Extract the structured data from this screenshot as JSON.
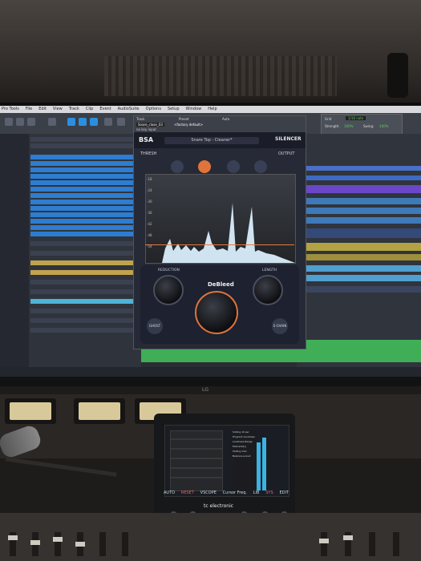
{
  "menubar": {
    "items": [
      "Pro Tools",
      "File",
      "Edit",
      "View",
      "Track",
      "Clip",
      "Event",
      "AudioSuite",
      "Options",
      "Setup",
      "Window",
      "Help"
    ]
  },
  "grid_panel": {
    "grid_label": "Grid",
    "grid_value": "1/16 note",
    "strength_label": "Strength:",
    "strength_value": "100%",
    "swing_label": "Swing:",
    "swing_value": "100%"
  },
  "plugin": {
    "track_label": "Track",
    "preset_label": "Preset",
    "auto_label": "Auto",
    "track_name": "Snare_close_03",
    "preset_value": "<factory default>",
    "key_input": "no key input",
    "brand": "BSA",
    "preset_name": "Snare Top - Cleaner*",
    "product": "SILENCER",
    "thresh_label": "THRESH",
    "output_label": "OUTPUT",
    "db_labels": [
      "-18",
      "-24",
      "-30",
      "-36",
      "-42",
      "-48",
      "-54"
    ],
    "reduction_label": "REDUCTION",
    "length_label": "LENGTH",
    "debleed_label": "DeBleed",
    "ghost_label": "GHOST",
    "schain_label": "S-CHAIN"
  },
  "tc_controller": {
    "logo": "tc electronic",
    "buttons": [
      "AUTO",
      "RESET",
      "VSCOPE",
      "Cursor Freq.",
      "LIB",
      "SYS",
      "EDIT"
    ],
    "params": [
      "Sliding 10 sec",
      "Program Loudness",
      "Loudness Range",
      "Momentary",
      "Sliding max",
      "Balance-a-loud"
    ]
  },
  "monitor": {
    "brand": "LG"
  },
  "colors": {
    "accent_orange": "#e0743a",
    "clip_green": "#3fae57",
    "highlight_blue": "#2a8fe0",
    "plugin_bg": "#262a36"
  }
}
